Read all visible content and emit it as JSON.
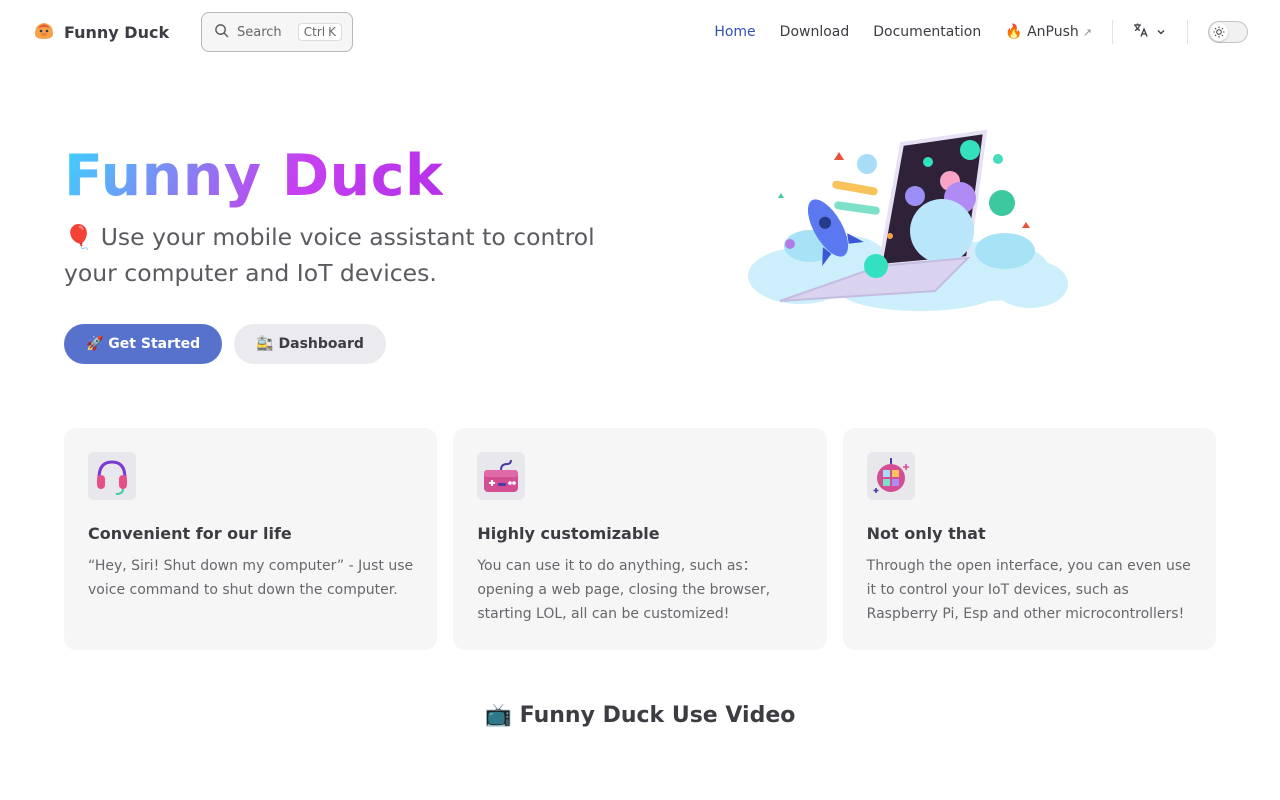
{
  "brand": {
    "title": "Funny Duck",
    "icon": "duck-logo-icon"
  },
  "search": {
    "label": "Search",
    "shortcut_ctrl": "Ctrl",
    "shortcut_key": "K"
  },
  "nav": {
    "links": [
      {
        "label": "Home",
        "active": true
      },
      {
        "label": "Download"
      },
      {
        "label": "Documentation"
      },
      {
        "label": "🔥 AnPush",
        "external": true,
        "external_glyph": "↗"
      }
    ],
    "language_icon": "translate-icon",
    "appearance_icon": "sun-icon"
  },
  "hero": {
    "name": "Funny Duck",
    "tagline": "🎈 Use your mobile voice assistant to control your computer and IoT devices.",
    "actions": [
      {
        "label": "🚀 Get Started",
        "theme": "brand"
      },
      {
        "label": "🚉 Dashboard",
        "theme": "alt"
      }
    ],
    "image": "rocket-laptop-illustration"
  },
  "features": [
    {
      "icon": "headphones-icon",
      "title": "Convenient for our life",
      "details": "“Hey, Siri! Shut down my computer” - Just use voice command to shut down the computer."
    },
    {
      "icon": "gamepad-icon",
      "title": "Highly customizable",
      "details": "You can use it to do anything, such as：opening a web page, closing the browser, starting LOL, all can be customized!"
    },
    {
      "icon": "disco-ball-icon",
      "title": "Not only that",
      "details": "Through the open interface, you can even use it to control your IoT devices, such as Raspberry Pi, Esp and other microcontrollers!"
    }
  ],
  "video_section": {
    "title": "📺 Funny Duck Use Video"
  },
  "colors": {
    "brand": "#5672cd",
    "link_active": "#3451b2",
    "text": "#3c3c43",
    "card_bg": "#f6f6f7"
  }
}
